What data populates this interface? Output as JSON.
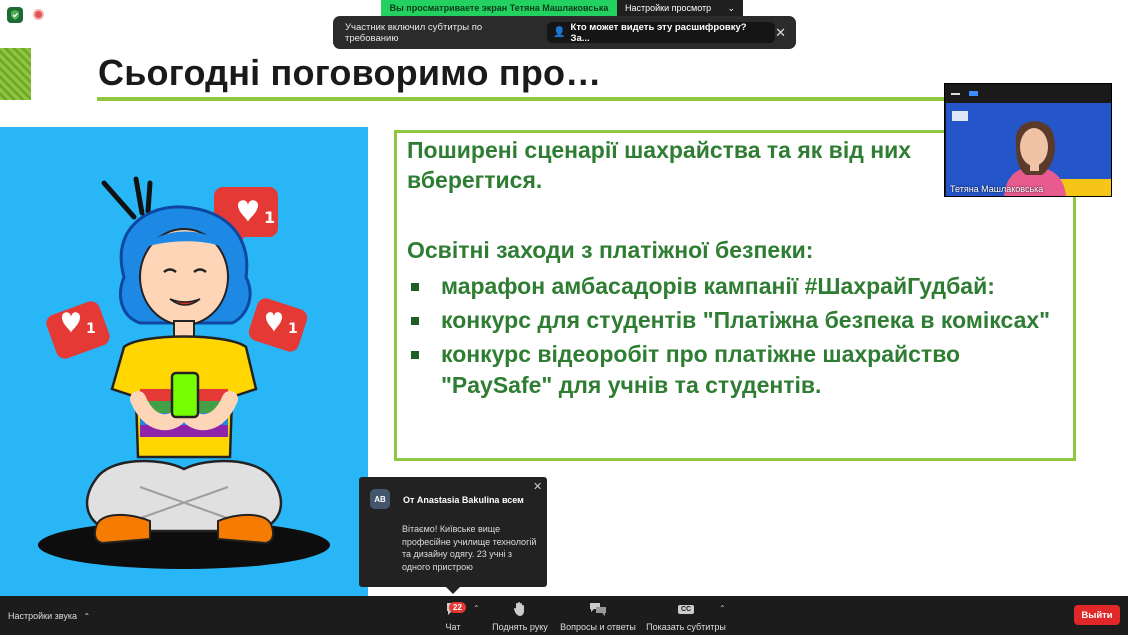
{
  "banner": {
    "viewing_text": "Вы просматриваете экран Тетяна Машлаковська",
    "view_options_label": "Настройки просмотр"
  },
  "captions_toast": {
    "message": "Участник включил субтитры по требованию",
    "who_can_see": "Кто может видеть эту расшифровку? За...",
    "close_glyph": "✕"
  },
  "slide": {
    "title": "Сьогодні поговоримо про…",
    "heading_1": "Поширені сценарії шахрайства та як від них вберегтися.",
    "heading_2": "Освітні заходи з платіжної безпеки:",
    "bullets": [
      "марафон амбасадорів кампанії #ШахрайГудбай:",
      "конкурс для студентів \"Платіжна безпека в коміксах\"",
      "конкурс відеоробіт про платіжне шахрайство \"PaySafe\" для учнів та студентів."
    ],
    "accent_green": "#8fc53f",
    "text_green": "#2e7d32",
    "illustration_bg": "#29b6f6"
  },
  "video_tile": {
    "participant_name": "Тетяна Машлаковська"
  },
  "chat_popup": {
    "avatar_initials": "AB",
    "from": "От Anastasia Bakulina всем",
    "message": "Вітаємо! Київське вище професійне училище технологій та дизайну одягу. 23 учні з одного пристрою",
    "close_glyph": "✕"
  },
  "toolbar": {
    "audio_settings": "Настройки звука",
    "chat_label": "Чат",
    "chat_badge": "22",
    "raise_hand_label": "Поднять руку",
    "qa_label": "Вопросы и ответы",
    "captions_label": "Показать субтитры",
    "captions_icon_text": "CC",
    "leave_label": "Выйти",
    "leave_color": "#e02828"
  }
}
